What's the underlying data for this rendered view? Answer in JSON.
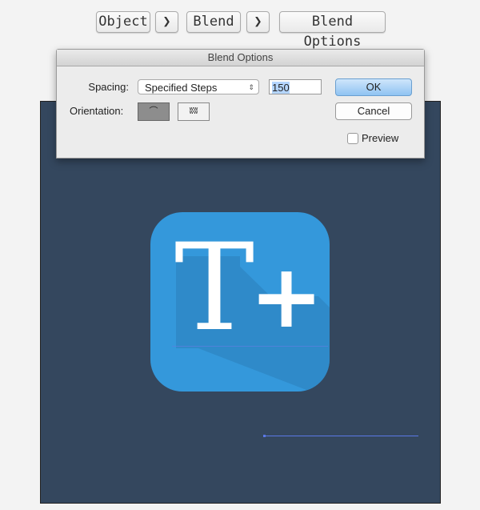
{
  "breadcrumb": {
    "items": [
      "Object",
      "Blend",
      "Blend Options"
    ],
    "separator_icon": "chevron-right-icon"
  },
  "dialog": {
    "title": "Blend Options",
    "spacing_label": "Spacing:",
    "spacing_value": "Specified Steps",
    "steps_value": "150",
    "orientation_label": "Orientation:",
    "ok_label": "OK",
    "cancel_label": "Cancel",
    "preview_label": "Preview",
    "preview_checked": false
  },
  "artwork": {
    "glyph_t": "T",
    "glyph_plus": "+",
    "canvas_color": "#34475e",
    "icon_color": "#3498db"
  }
}
